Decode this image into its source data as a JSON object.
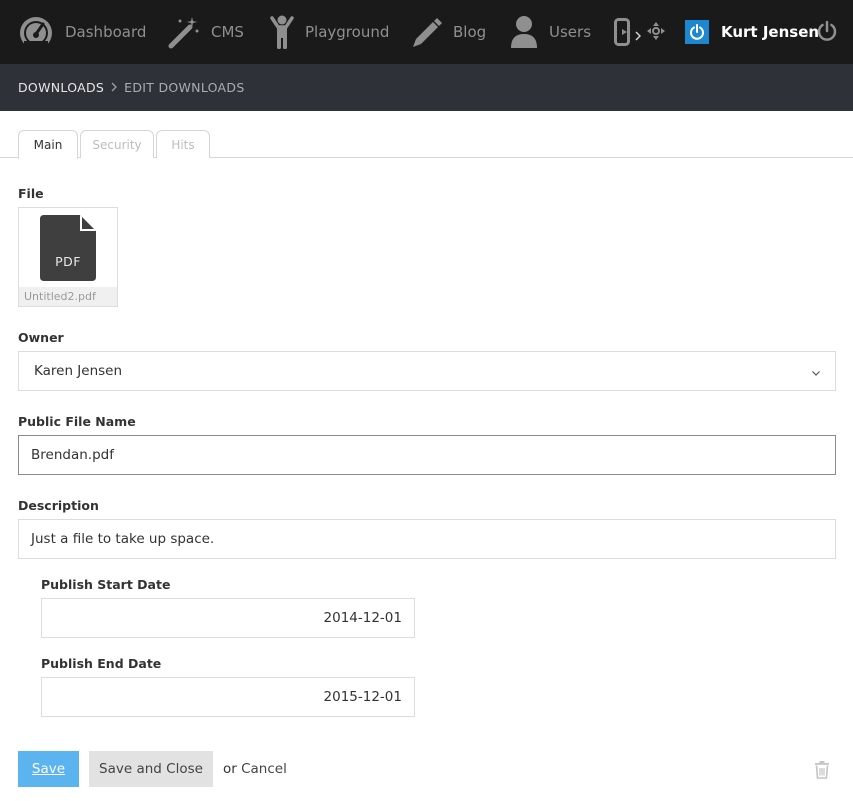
{
  "nav": {
    "items": [
      {
        "label": "Dashboard",
        "icon": "dashboard-gauge-icon"
      },
      {
        "label": "CMS",
        "icon": "magic-wand-icon"
      },
      {
        "label": "Playground",
        "icon": "child-figure-icon"
      },
      {
        "label": "Blog",
        "icon": "pencil-icon"
      },
      {
        "label": "Users",
        "icon": "user-icon"
      }
    ],
    "more_icons": [
      "device-icon",
      "chevron-right-icon",
      "move-arrows-icon"
    ],
    "user": {
      "name": "Kurt Jensen",
      "badge_icon": "power-icon"
    },
    "logout_icon": "power-icon",
    "colors": {
      "bar": "#1a1a1a",
      "badge": "#1d87d0",
      "nav_text": "#8f8f8f"
    }
  },
  "breadcrumb": {
    "parent": "DOWNLOADS",
    "current": "EDIT DOWNLOADS"
  },
  "tabs": [
    {
      "label": "Main",
      "active": true
    },
    {
      "label": "Security",
      "active": false
    },
    {
      "label": "Hits",
      "active": false
    }
  ],
  "form": {
    "file": {
      "label": "File",
      "type_badge": "PDF",
      "filename": "Untitled2.pdf"
    },
    "owner": {
      "label": "Owner",
      "value": "Karen Jensen"
    },
    "public_file_name": {
      "label": "Public File Name",
      "value": "Brendan.pdf"
    },
    "description": {
      "label": "Description",
      "value": "Just a file to take up space."
    },
    "publish_start": {
      "label": "Publish Start Date",
      "value": "2014-12-01"
    },
    "publish_end": {
      "label": "Publish End Date",
      "value": "2015-12-01"
    }
  },
  "actions": {
    "save": "Save",
    "save_close": "Save and Close",
    "or": "or",
    "cancel": "Cancel",
    "delete_icon": "trash-icon",
    "colors": {
      "save": "#5bb3f0",
      "save_close": "#e2e2e2"
    }
  }
}
